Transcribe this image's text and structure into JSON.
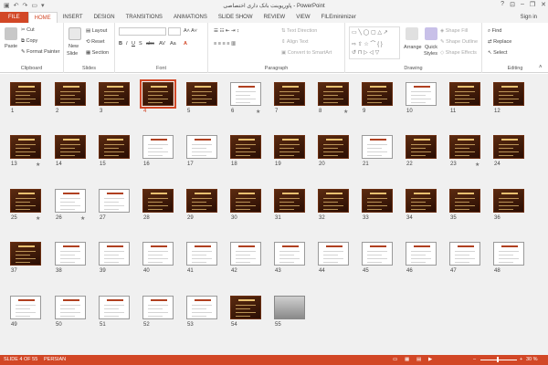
{
  "title_bar": {
    "title": "پاورپوینت بانک داری اختصاصی - PowerPoint",
    "win_help": "?",
    "win_min": "–",
    "win_restore": "❐",
    "win_close": "✕"
  },
  "tabs": [
    {
      "label": "FILE"
    },
    {
      "label": "HOME"
    },
    {
      "label": "INSERT"
    },
    {
      "label": "DESIGN"
    },
    {
      "label": "TRANSITIONS"
    },
    {
      "label": "ANIMATIONS"
    },
    {
      "label": "SLIDE SHOW"
    },
    {
      "label": "REVIEW"
    },
    {
      "label": "VIEW"
    },
    {
      "label": "FILEminimizer"
    }
  ],
  "signin": "Sign in",
  "ribbon": {
    "clipboard": {
      "label": "Clipboard",
      "paste": "Paste",
      "cut": "Cut",
      "copy": "Copy",
      "format_painter": "Format Painter"
    },
    "slides": {
      "label": "Slides",
      "new_slide": "New",
      "new_slide2": "Slide",
      "layout": "Layout",
      "reset": "Reset",
      "section": "Section"
    },
    "font": {
      "label": "Font"
    },
    "paragraph": {
      "label": "Paragraph",
      "text_direction": "Text Direction",
      "align_text": "Align Text",
      "convert_smartart": "Convert to SmartArt"
    },
    "drawing": {
      "label": "Drawing",
      "arrange": "Arrange",
      "quick_styles": "Quick",
      "quick_styles2": "Styles",
      "shape_fill": "Shape Fill",
      "shape_outline": "Shape Outline",
      "shape_effects": "Shape Effects"
    },
    "editing": {
      "label": "Editing",
      "find": "Find",
      "replace": "Replace",
      "select": "Select"
    }
  },
  "slides": [
    {
      "n": "1",
      "style": "dark"
    },
    {
      "n": "2",
      "style": "dark"
    },
    {
      "n": "3",
      "style": "dark"
    },
    {
      "n": "4",
      "style": "dark",
      "selected": true
    },
    {
      "n": "5",
      "style": "dark"
    },
    {
      "n": "6",
      "style": "white",
      "star": true
    },
    {
      "n": "7",
      "style": "dark"
    },
    {
      "n": "8",
      "style": "dark",
      "star": true
    },
    {
      "n": "9",
      "style": "dark"
    },
    {
      "n": "10",
      "style": "white"
    },
    {
      "n": "11",
      "style": "dark"
    },
    {
      "n": "12",
      "style": "dark"
    },
    {
      "n": "13",
      "style": "dark",
      "star": true
    },
    {
      "n": "14",
      "style": "dark"
    },
    {
      "n": "15",
      "style": "dark"
    },
    {
      "n": "16",
      "style": "white"
    },
    {
      "n": "17",
      "style": "white"
    },
    {
      "n": "18",
      "style": "dark"
    },
    {
      "n": "19",
      "style": "dark"
    },
    {
      "n": "20",
      "style": "dark"
    },
    {
      "n": "21",
      "style": "white"
    },
    {
      "n": "22",
      "style": "dark"
    },
    {
      "n": "23",
      "style": "dark",
      "star": true
    },
    {
      "n": "24",
      "style": "dark"
    },
    {
      "n": "25",
      "style": "dark",
      "star": true
    },
    {
      "n": "26",
      "style": "white",
      "star": true
    },
    {
      "n": "27",
      "style": "white"
    },
    {
      "n": "28",
      "style": "dark"
    },
    {
      "n": "29",
      "style": "dark"
    },
    {
      "n": "30",
      "style": "dark"
    },
    {
      "n": "31",
      "style": "dark"
    },
    {
      "n": "32",
      "style": "dark"
    },
    {
      "n": "33",
      "style": "dark"
    },
    {
      "n": "34",
      "style": "dark"
    },
    {
      "n": "35",
      "style": "dark"
    },
    {
      "n": "36",
      "style": "dark"
    },
    {
      "n": "37",
      "style": "dark"
    },
    {
      "n": "38",
      "style": "white"
    },
    {
      "n": "39",
      "style": "white"
    },
    {
      "n": "40",
      "style": "white"
    },
    {
      "n": "41",
      "style": "white"
    },
    {
      "n": "42",
      "style": "white"
    },
    {
      "n": "43",
      "style": "white"
    },
    {
      "n": "44",
      "style": "white"
    },
    {
      "n": "45",
      "style": "white"
    },
    {
      "n": "46",
      "style": "white"
    },
    {
      "n": "47",
      "style": "white"
    },
    {
      "n": "48",
      "style": "white"
    },
    {
      "n": "49",
      "style": "white"
    },
    {
      "n": "50",
      "style": "white"
    },
    {
      "n": "51",
      "style": "white"
    },
    {
      "n": "52",
      "style": "white"
    },
    {
      "n": "53",
      "style": "white"
    },
    {
      "n": "54",
      "style": "dark"
    },
    {
      "n": "55",
      "style": "photo"
    }
  ],
  "status": {
    "slide_of": "SLIDE 4 OF 55",
    "language": "PERSIAN",
    "zoom": "30 %"
  },
  "colors": {
    "accent": "#d24726"
  }
}
